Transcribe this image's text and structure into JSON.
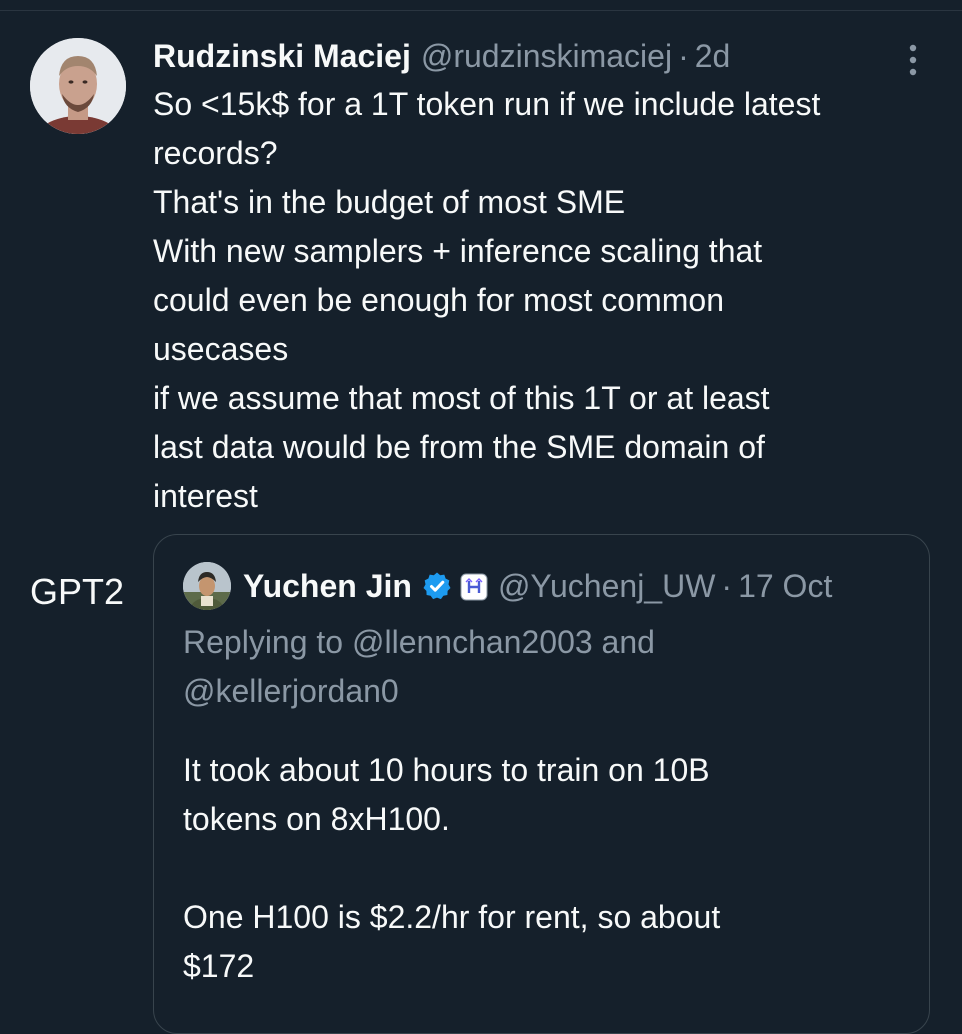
{
  "tweet": {
    "author_name": "Rudzinski Maciej",
    "author_handle": "@rudzinskimaciej",
    "separator": "·",
    "time": "2d",
    "text_lines": [
      "So <15k$ for a 1T token run if we include latest",
      "records?",
      "That's in the budget of most SME",
      "With new samplers + inference scaling that",
      "could even be enough for most common",
      "usecases",
      "if we assume that most of this 1T or at least",
      "last data would be from the SME domain of",
      "interest"
    ],
    "more_icon": "more-vertical-icon",
    "avatar_icon": "user-avatar"
  },
  "side_label": "GPT2",
  "quote": {
    "author_name": "Yuchen Jin",
    "verified_icon": "verified-badge-icon",
    "affiliate_icon": "affiliate-badge-icon",
    "author_handle": "@Yuchenj_UW",
    "separator": "·",
    "time": "17 Oct",
    "replying_prefix": "Replying to",
    "reply_mention_1": "@llennchan2003",
    "reply_and": "and",
    "reply_mention_2": "@kellerjordan0",
    "body_lines": [
      "It took about 10 hours to train on 10B",
      "tokens on 8xH100.",
      "",
      "One H100 is $2.2/hr for rent, so about",
      "$172"
    ]
  },
  "colors": {
    "background": "#15202b",
    "text_primary": "#f7f9f9",
    "text_secondary": "#8b98a5",
    "border": "#38444d",
    "verified_blue": "#1d9bf0"
  }
}
